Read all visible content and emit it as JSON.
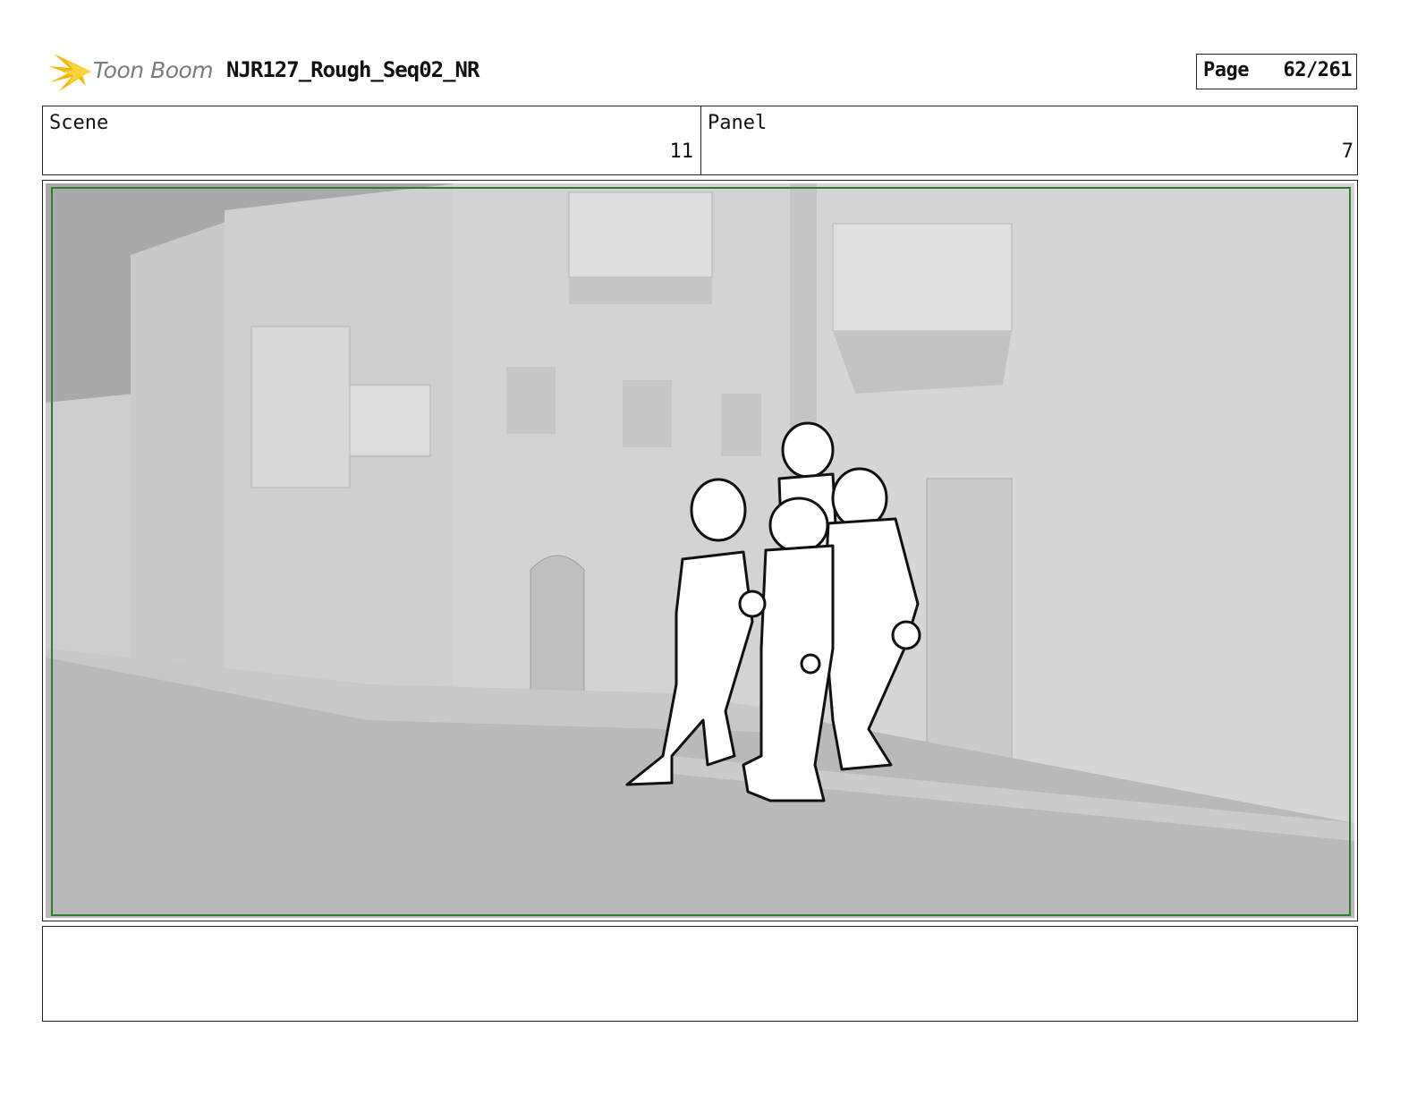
{
  "header": {
    "logo_text": "Toon Boom",
    "project_title": "NJR127_Rough_Seq02_NR",
    "page_label": "Page",
    "page_value": "62/261"
  },
  "info": {
    "scene_label": "Scene",
    "scene_value": "11",
    "panel_label": "Panel",
    "panel_value": "7"
  },
  "panel": {
    "description_icon": "storyboard-drawing",
    "safe_frame_color": "#2e7d32"
  },
  "notes": {
    "text": ""
  }
}
